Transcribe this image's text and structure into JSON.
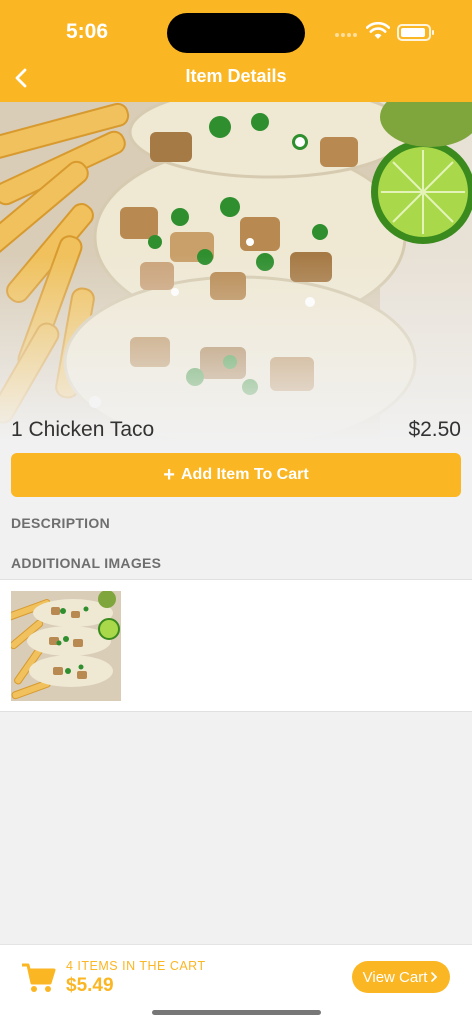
{
  "status": {
    "time": "5:06"
  },
  "header": {
    "title": "Item Details"
  },
  "item": {
    "name": "1 Chicken Taco",
    "price": "$2.50"
  },
  "actions": {
    "add_to_cart_label": "Add Item To Cart",
    "add_icon": "plus-icon"
  },
  "sections": {
    "description_label": "DESCRIPTION",
    "additional_images_label": "ADDITIONAL IMAGES"
  },
  "cart": {
    "items_label": "4 ITEMS IN THE CART",
    "total": "$5.49",
    "view_cart_label": "View Cart",
    "cart_icon": "shopping-cart-icon"
  },
  "colors": {
    "accent": "#fbb623",
    "background": "#f1f1f1",
    "text": "#333333",
    "label": "#6e6e6e"
  }
}
